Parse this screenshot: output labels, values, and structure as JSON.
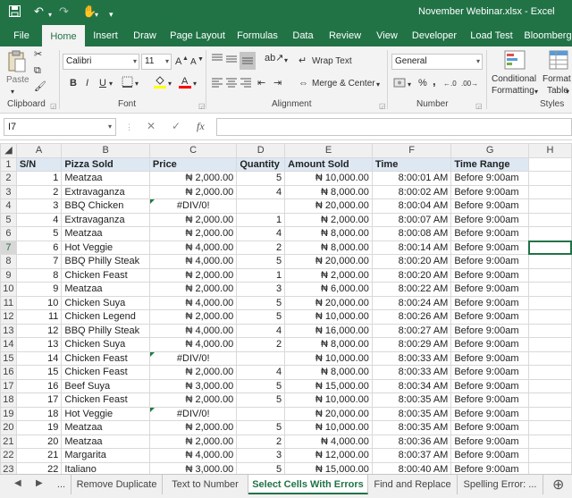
{
  "window": {
    "title": "November Webinar.xlsx  -  Excel"
  },
  "quick_access": {
    "icons": [
      "save-icon",
      "undo-icon",
      "undo-dropdown-icon",
      "redo-icon",
      "touch-mode-icon",
      "customize-icon"
    ]
  },
  "tabs": [
    "File",
    "Home",
    "Insert",
    "Draw",
    "Page Layout",
    "Formulas",
    "Data",
    "Review",
    "View",
    "Developer",
    "Load Test",
    "Bloomberg"
  ],
  "active_tab": "Home",
  "ribbon": {
    "clipboard": {
      "paste": "Paste",
      "label": "Clipboard"
    },
    "font": {
      "name": "Calibri",
      "size": "11",
      "label": "Font",
      "bold": "B",
      "italic": "I",
      "underline": "U",
      "grow": "A",
      "shrink": "A"
    },
    "alignment": {
      "wrap": "Wrap Text",
      "merge": "Merge & Center",
      "label": "Alignment"
    },
    "number": {
      "format": "General",
      "label": "Number",
      "pct": "%",
      "comma": ","
    },
    "styles": {
      "conditional": "Conditional",
      "conditional2": "Formatting",
      "format_as": "Format as",
      "format_as2": "Table",
      "label": "Styles"
    }
  },
  "formula_bar": {
    "name_box": "I7",
    "fx": "fx",
    "cancel": "✕",
    "enter": "✓",
    "value": ""
  },
  "columns": [
    "A",
    "B",
    "C",
    "D",
    "E",
    "F",
    "G",
    "H"
  ],
  "headers": [
    "S/N",
    "Pizza Sold",
    "Price",
    "Quantity",
    "Amount Sold",
    "Time",
    "Time Range"
  ],
  "rows": [
    [
      "1",
      "Meatzaa",
      "₦ 2,000.00",
      "5",
      "₦ 10,000.00",
      "8:00:01 AM",
      "Before 9:00am"
    ],
    [
      "2",
      "Extravaganza",
      "₦ 2,000.00",
      "4",
      "₦ 8,000.00",
      "8:00:02 AM",
      "Before 9:00am"
    ],
    [
      "3",
      "BBQ Chicken",
      "#DIV/0!",
      "",
      "₦ 20,000.00",
      "8:00:04 AM",
      "Before 9:00am"
    ],
    [
      "4",
      "Extravaganza",
      "₦ 2,000.00",
      "1",
      "₦ 2,000.00",
      "8:00:07 AM",
      "Before 9:00am"
    ],
    [
      "5",
      "Meatzaa",
      "₦ 2,000.00",
      "4",
      "₦ 8,000.00",
      "8:00:08 AM",
      "Before 9:00am"
    ],
    [
      "6",
      "Hot Veggie",
      "₦ 4,000.00",
      "2",
      "₦ 8,000.00",
      "8:00:14 AM",
      "Before 9:00am"
    ],
    [
      "7",
      "BBQ Philly Steak",
      "₦ 4,000.00",
      "5",
      "₦ 20,000.00",
      "8:00:20 AM",
      "Before 9:00am"
    ],
    [
      "8",
      "Chicken Feast",
      "₦ 2,000.00",
      "1",
      "₦ 2,000.00",
      "8:00:20 AM",
      "Before 9:00am"
    ],
    [
      "9",
      "Meatzaa",
      "₦ 2,000.00",
      "3",
      "₦ 6,000.00",
      "8:00:22 AM",
      "Before 9:00am"
    ],
    [
      "10",
      "Chicken Suya",
      "₦ 4,000.00",
      "5",
      "₦ 20,000.00",
      "8:00:24 AM",
      "Before 9:00am"
    ],
    [
      "11",
      "Chicken Legend",
      "₦ 2,000.00",
      "5",
      "₦ 10,000.00",
      "8:00:26 AM",
      "Before 9:00am"
    ],
    [
      "12",
      "BBQ Philly Steak",
      "₦ 4,000.00",
      "4",
      "₦ 16,000.00",
      "8:00:27 AM",
      "Before 9:00am"
    ],
    [
      "13",
      "Chicken Suya",
      "₦ 4,000.00",
      "2",
      "₦ 8,000.00",
      "8:00:29 AM",
      "Before 9:00am"
    ],
    [
      "14",
      "Chicken Feast",
      "#DIV/0!",
      "",
      "₦ 10,000.00",
      "8:00:33 AM",
      "Before 9:00am"
    ],
    [
      "15",
      "Chicken Feast",
      "₦ 2,000.00",
      "4",
      "₦ 8,000.00",
      "8:00:33 AM",
      "Before 9:00am"
    ],
    [
      "16",
      "Beef Suya",
      "₦ 3,000.00",
      "5",
      "₦ 15,000.00",
      "8:00:34 AM",
      "Before 9:00am"
    ],
    [
      "17",
      "Chicken Feast",
      "₦ 2,000.00",
      "5",
      "₦ 10,000.00",
      "8:00:35 AM",
      "Before 9:00am"
    ],
    [
      "18",
      "Hot Veggie",
      "#DIV/0!",
      "",
      "₦ 20,000.00",
      "8:00:35 AM",
      "Before 9:00am"
    ],
    [
      "19",
      "Meatzaa",
      "₦ 2,000.00",
      "5",
      "₦ 10,000.00",
      "8:00:35 AM",
      "Before 9:00am"
    ],
    [
      "20",
      "Meatzaa",
      "₦ 2,000.00",
      "2",
      "₦ 4,000.00",
      "8:00:36 AM",
      "Before 9:00am"
    ],
    [
      "21",
      "Margarita",
      "₦ 4,000.00",
      "3",
      "₦ 12,000.00",
      "8:00:37 AM",
      "Before 9:00am"
    ],
    [
      "22",
      "Italiano",
      "₦ 3,000.00",
      "5",
      "₦ 15,000.00",
      "8:00:40 AM",
      "Before 9:00am"
    ]
  ],
  "sheet_tabs": [
    "...",
    "Remove Duplicate",
    "Text to Number",
    "Select Cells With Errors",
    "Find and Replace",
    "Spelling Error: ..."
  ],
  "active_sheet": "Select Cells With Errors",
  "colors": {
    "accent": "#217346",
    "header_fill": "#dde8f3",
    "error_marker": "#1e7b45"
  }
}
